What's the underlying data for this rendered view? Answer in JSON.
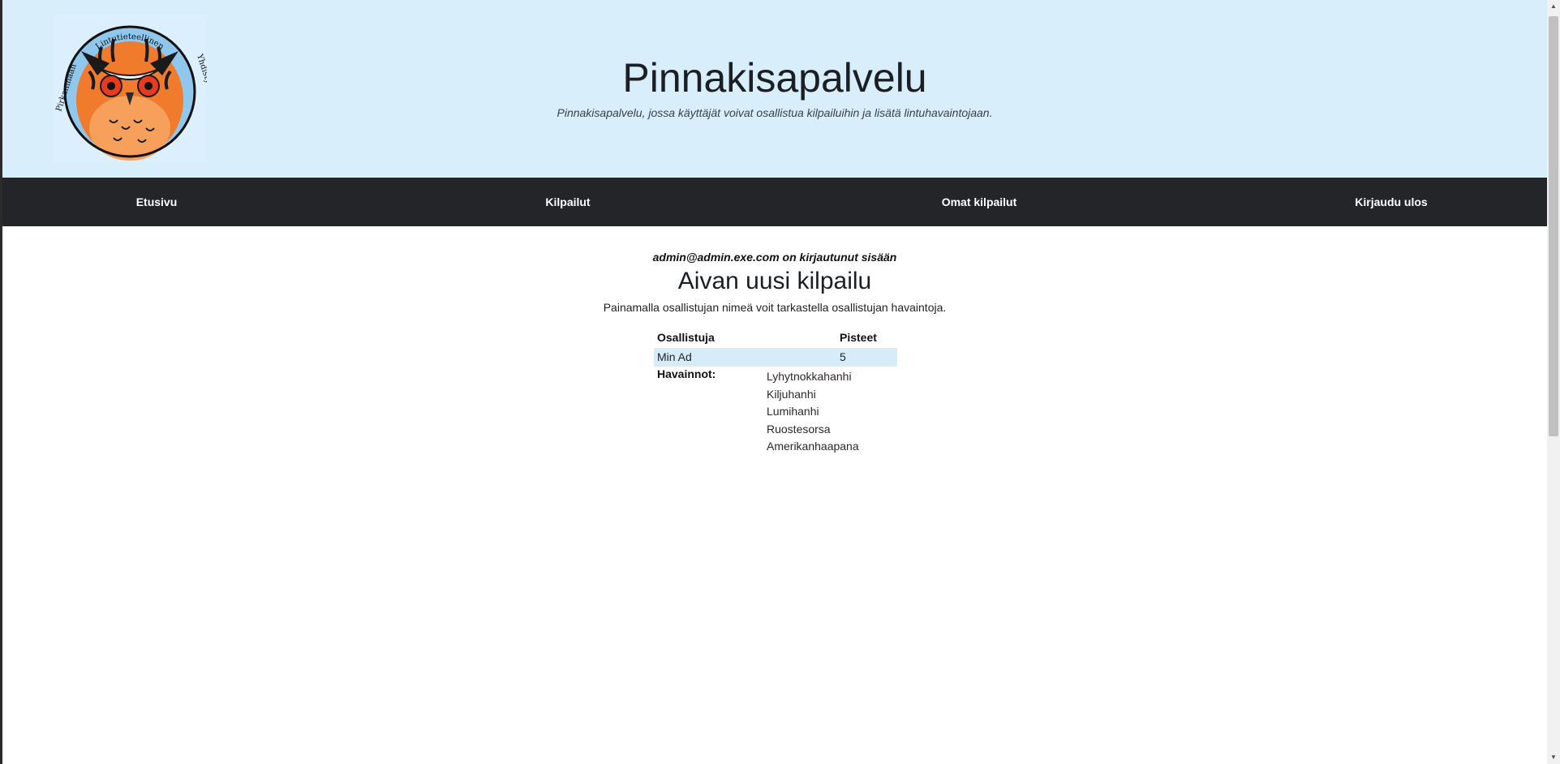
{
  "header": {
    "title": "Pinnakisapalvelu",
    "subtitle": "Pinnakisapalvelu, jossa käyttäjät voivat osallistua kilpailuihin ja lisätä lintuhavaintojaan.",
    "logo": {
      "text_top": "Lintutieteellinen",
      "text_left": "Pirkanmaan",
      "text_right": "Yhdistys ry"
    }
  },
  "nav": {
    "items": [
      "Etusivu",
      "Kilpailut",
      "Omat kilpailut",
      "Kirjaudu ulos"
    ]
  },
  "main": {
    "logged_in_text": "admin@admin.exe.com on kirjautunut sisään",
    "competition_title": "Aivan uusi kilpailu",
    "instructions": "Painamalla osallistujan nimeä voit tarkastella osallistujan havaintoja.",
    "table": {
      "headers": [
        "Osallistuja",
        "Pisteet"
      ],
      "rows": [
        {
          "participant": "Min Ad",
          "points": "5"
        }
      ]
    },
    "observations_label": "Havainnot:",
    "observations": [
      "Lyhytnokkahanhi",
      "Kiljuhanhi",
      "Lumihanhi",
      "Ruostesorsa",
      "Amerikanhaapana"
    ]
  },
  "colors": {
    "header_bg": "#d8eefb",
    "navbar_bg": "#232528",
    "row_highlight": "#d6ecf9",
    "owl_orange": "#f07b2c"
  }
}
